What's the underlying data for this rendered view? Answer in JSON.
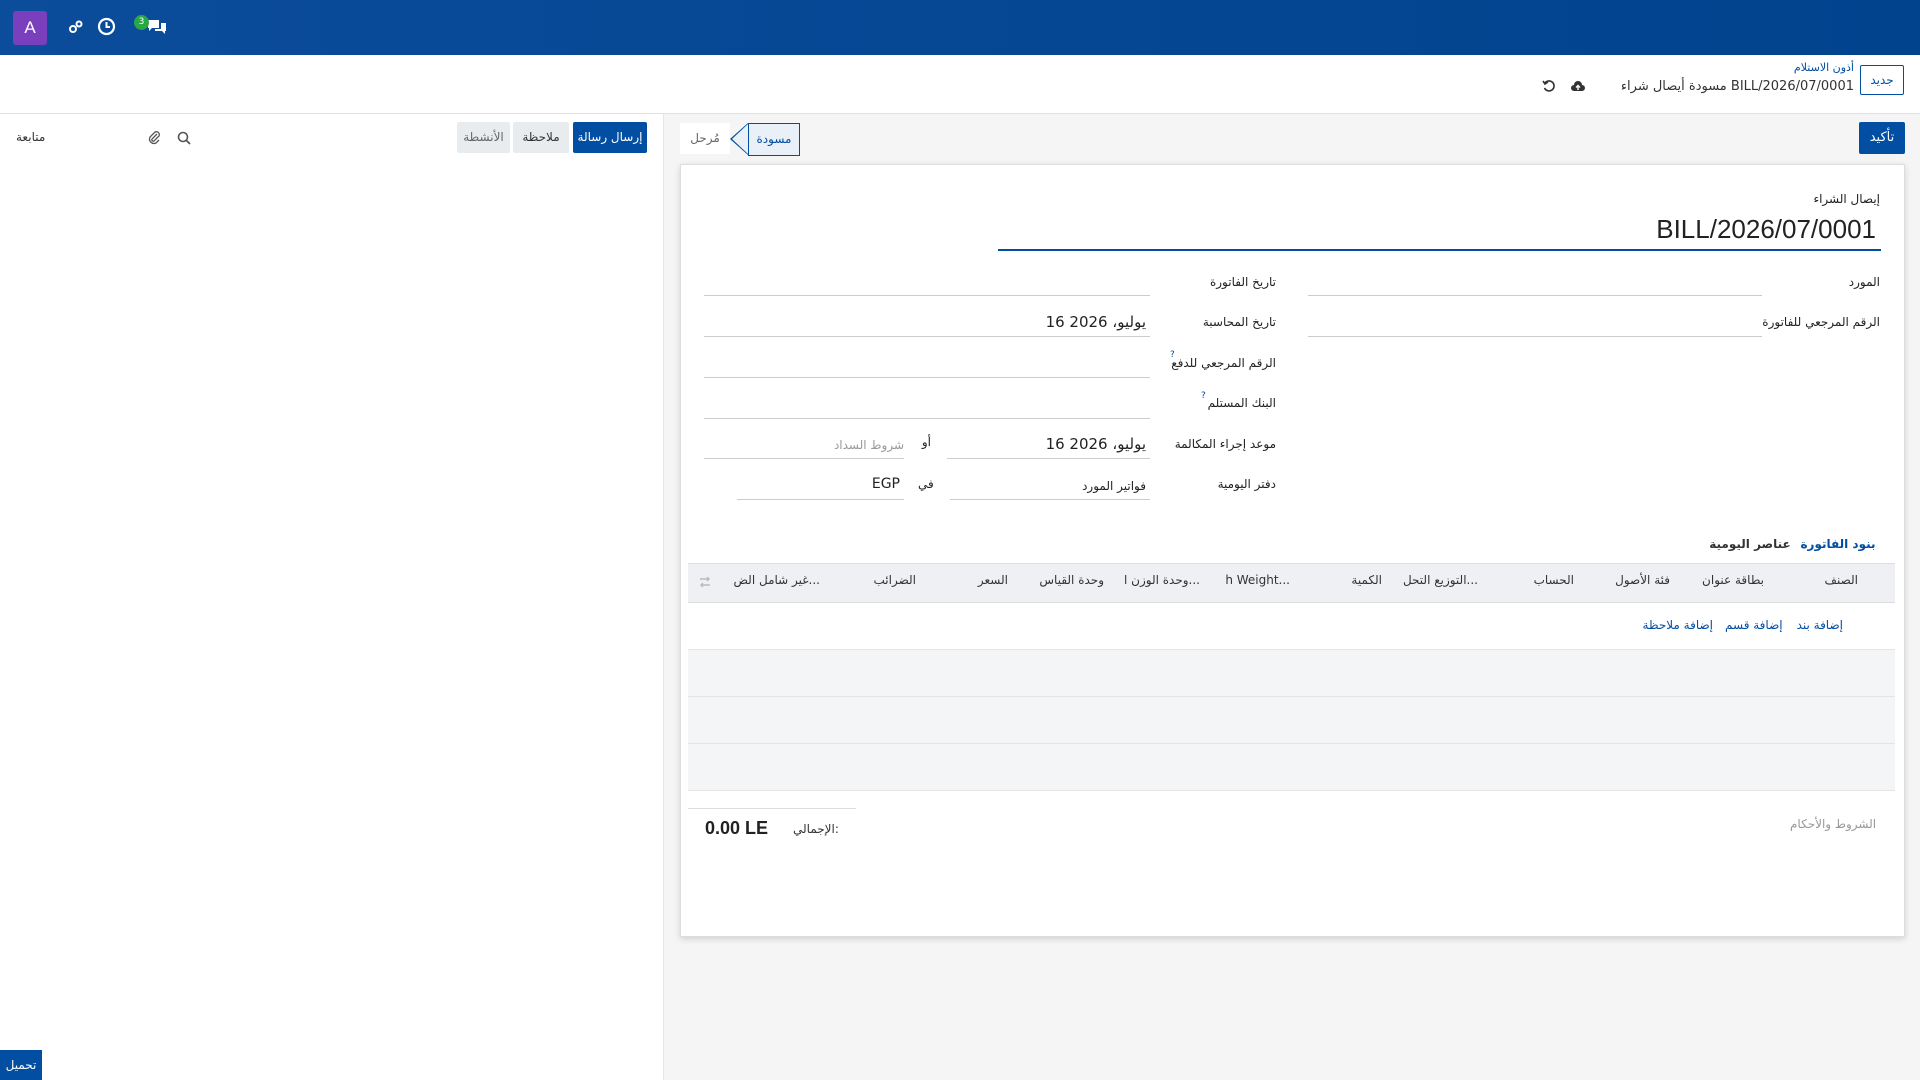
{
  "navbar": {
    "avatar_letter": "A",
    "messages_badge": "3"
  },
  "controlpanel": {
    "new_button": "جديد",
    "breadcrumb_parent": "أذون الاستلام",
    "breadcrumb_current": "مسودة أيصال شراء BILL/2026/07/0001"
  },
  "chatter": {
    "send_message": "إرسال رسالة",
    "log_note": "ملاحظة",
    "activities": "الأنشطة",
    "follow": "متابعة",
    "download": "تحميل"
  },
  "header": {
    "confirm": "تأكيد",
    "status_draft": "مسودة",
    "status_posted": "مُرحل"
  },
  "form": {
    "doc_type": "إيصال الشراء",
    "name": "BILL/2026/07/0001",
    "vendor_label": "المورد",
    "vendor_ref_label": "الرقم المرجعي للفاتورة",
    "invoice_date_label": "تاريخ الفاتورة",
    "accounting_date_label": "تاريخ المحاسبة",
    "accounting_date_value": "16 يوليو، 2026",
    "payment_ref_label": "الرقم المرجعي للدفع",
    "recipient_bank_label": "البنك المستلم",
    "due_date_label": "موعد إجراء المكالمة",
    "due_date_value": "16 يوليو، 2026",
    "or_label": "أو",
    "payment_terms_placeholder": "شروط السداد",
    "journal_label": "دفتر اليومية",
    "journal_value": "فواتير المورد",
    "in_label": "في",
    "currency": "EGP",
    "help_mark": "?"
  },
  "tabs": {
    "invoice_lines": "بنود الفاتورة",
    "journal_items": "عناصر اليومية"
  },
  "table": {
    "columns": [
      "الصنف",
      "بطاقة عنوان",
      "فئة الأصول",
      "الحساب",
      "التوزيع التحل...",
      "الكمية",
      "h Weight...",
      "وحدة الوزن ا...",
      "وحدة القياس",
      "السعر",
      "الضرائب",
      "غير شامل الض..."
    ],
    "add_line": "إضافة بند",
    "add_section": "إضافة قسم",
    "add_note": "إضافة ملاحظة"
  },
  "footer": {
    "terms_placeholder": "الشروط والأحكام",
    "total_label": "الإجمالي:",
    "total_value": "0.00 LE"
  }
}
